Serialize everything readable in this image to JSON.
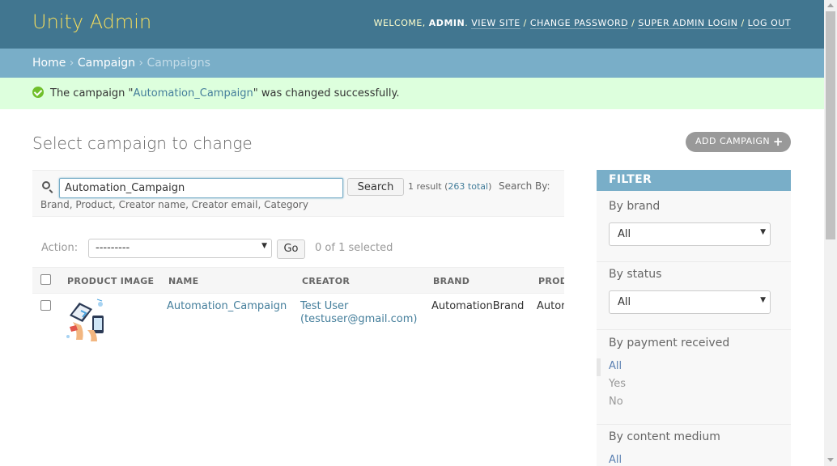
{
  "header": {
    "brand": "Unity Admin",
    "welcome": "Welcome, ",
    "username": "admin",
    "links": [
      "View site",
      "Change password",
      "Super Admin Login",
      "Log out"
    ]
  },
  "breadcrumbs": {
    "home": "Home",
    "app": "Campaign",
    "current": "Campaigns"
  },
  "message": {
    "prefix": "The campaign \"",
    "link": "Automation_Campaign",
    "suffix": "\" was changed successfully."
  },
  "content": {
    "title": "Select campaign to change",
    "add_button": "Add campaign",
    "add_icon": "+"
  },
  "search": {
    "value": "Automation_Campaign",
    "button": "Search",
    "result_prefix": "1 result (",
    "result_total": "263 total",
    "result_suffix": ")",
    "search_by": "Search By:",
    "fields": "Brand, Product, Creator name, Creator email, Category"
  },
  "actions": {
    "label": "Action:",
    "selected": "---------",
    "go": "Go",
    "counter": "0 of 1 selected"
  },
  "table": {
    "headers": [
      "Product image",
      "Name",
      "Creator",
      "Brand",
      "Prod"
    ],
    "rows": [
      {
        "name": "Automation_Campaign",
        "creator_line1": "Test User",
        "creator_line2": "(testuser@gmail.com)",
        "brand": "AutomationBrand",
        "product": "Autor"
      }
    ]
  },
  "filter": {
    "title": "Filter",
    "by_brand": "By brand",
    "brand_value": "All",
    "by_status": "By status",
    "status_value": "All",
    "by_payment": "By payment received",
    "payment_options": [
      "All",
      "Yes",
      "No"
    ],
    "by_medium": "By content medium",
    "medium_first": "All"
  },
  "icons": {
    "success": "check-circle-icon",
    "search": "magnifier-icon",
    "add": "plus-icon",
    "dropdown": "triangle-down-icon"
  },
  "colors": {
    "header_bg": "#417690",
    "brand": "#f5dd5d",
    "breadcrumb_bg": "#79aec8",
    "message_bg": "#dddddd",
    "link": "#447e9b"
  }
}
